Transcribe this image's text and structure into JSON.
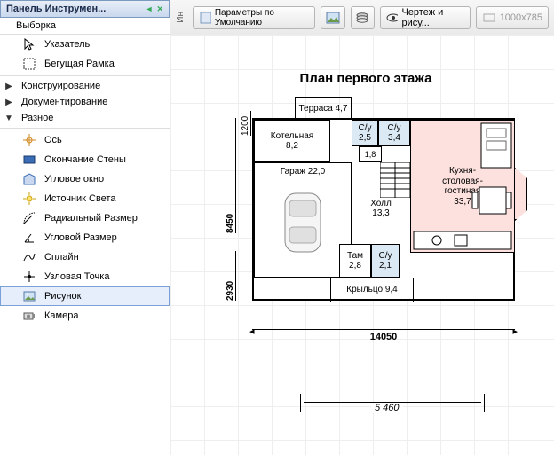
{
  "toolbox": {
    "title": "Панель Инструмен...",
    "group_selection": "Выборка",
    "pointer": "Указатель",
    "marquee": "Бегущая Рамка",
    "group_construct": "Конструирование",
    "group_document": "Документирование",
    "group_misc": "Разное",
    "axis": "Ось",
    "wall_end": "Окончание Стены",
    "corner_window": "Угловое окно",
    "light": "Источник Света",
    "radial_dim": "Радиальный Размер",
    "angle_dim": "Угловой Размер",
    "spline": "Сплайн",
    "node_point": "Узловая Точка",
    "picture": "Рисунок",
    "camera": "Камера"
  },
  "topbar": {
    "side_label": "Ин",
    "params": "Параметры по Умолчанию",
    "draw_btn": "Чертеж и рису...",
    "size": "1000x785"
  },
  "plan": {
    "title": "План первого этажа",
    "dim_top": "1200",
    "dim_left_top": "8450",
    "dim_left_bot": "2930",
    "dim_bottom": "14050",
    "extra_dim": "5 460",
    "rooms": {
      "terrace": "Терраса 4,7",
      "boiler_l1": "Котельная",
      "boiler_l2": "8,2",
      "su1_l1": "С/у",
      "su1_l2": "2,5",
      "su2_l1": "С/у",
      "su2_l2": "3,4",
      "small18": "1,8",
      "garage": "Гараж 22,0",
      "hall_l1": "Холл",
      "hall_l2": "13,3",
      "kitchen_l1": "Кухня-",
      "kitchen_l2": "столовая-",
      "kitchen_l3": "гостиная",
      "kitchen_l4": "33,7",
      "tam_l1": "Там",
      "tam_l2": "2,8",
      "su3_l1": "С/у",
      "su3_l2": "2,1",
      "porch": "Крыльцо 9,4"
    }
  }
}
